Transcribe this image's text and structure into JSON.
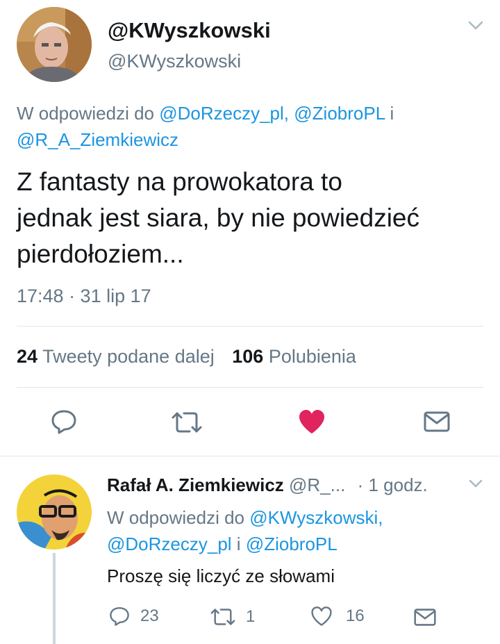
{
  "tweet": {
    "display_name": "@KWyszkowski",
    "handle": "@KWyszkowski",
    "reply_prefix": "W odpowiedzi do",
    "reply_to_1": "@DoRzeczy_pl,",
    "reply_to_2": "@ZiobroPL",
    "reply_conj": "i",
    "reply_to_3": "@R_A_Ziemkiewicz",
    "text": "Z fantasty na prowokatora to jednak jest siara, by nie powiedzieć pierdołoziem...",
    "timestamp": "17:48 · 31 lip 17",
    "retweets_count": "24",
    "retweets_label": "Tweety podane dalej",
    "likes_count": "106",
    "likes_label": "Polubienia",
    "liked_color": "#e0245e"
  },
  "reply": {
    "display_name": "Rafał A. Ziemkiewicz",
    "handle": "@R_...",
    "time": "· 1 godz.",
    "reply_prefix": "W odpowiedzi do",
    "reply_to_1": "@KWyszkowski,",
    "reply_to_2": "@DoRzeczy_pl",
    "reply_conj": "i",
    "reply_to_3": "@ZiobroPL",
    "text": "Proszę się liczyć ze słowami",
    "reply_count": "23",
    "retweet_count": "1",
    "like_count": "16"
  },
  "icons": {
    "reply": "reply-icon",
    "retweet": "retweet-icon",
    "like": "heart-icon",
    "message": "envelope-icon",
    "chevron": "chevron-down-icon"
  },
  "colors": {
    "link": "#1b95e0",
    "muted": "#657786",
    "divider": "#e1e8ed"
  }
}
